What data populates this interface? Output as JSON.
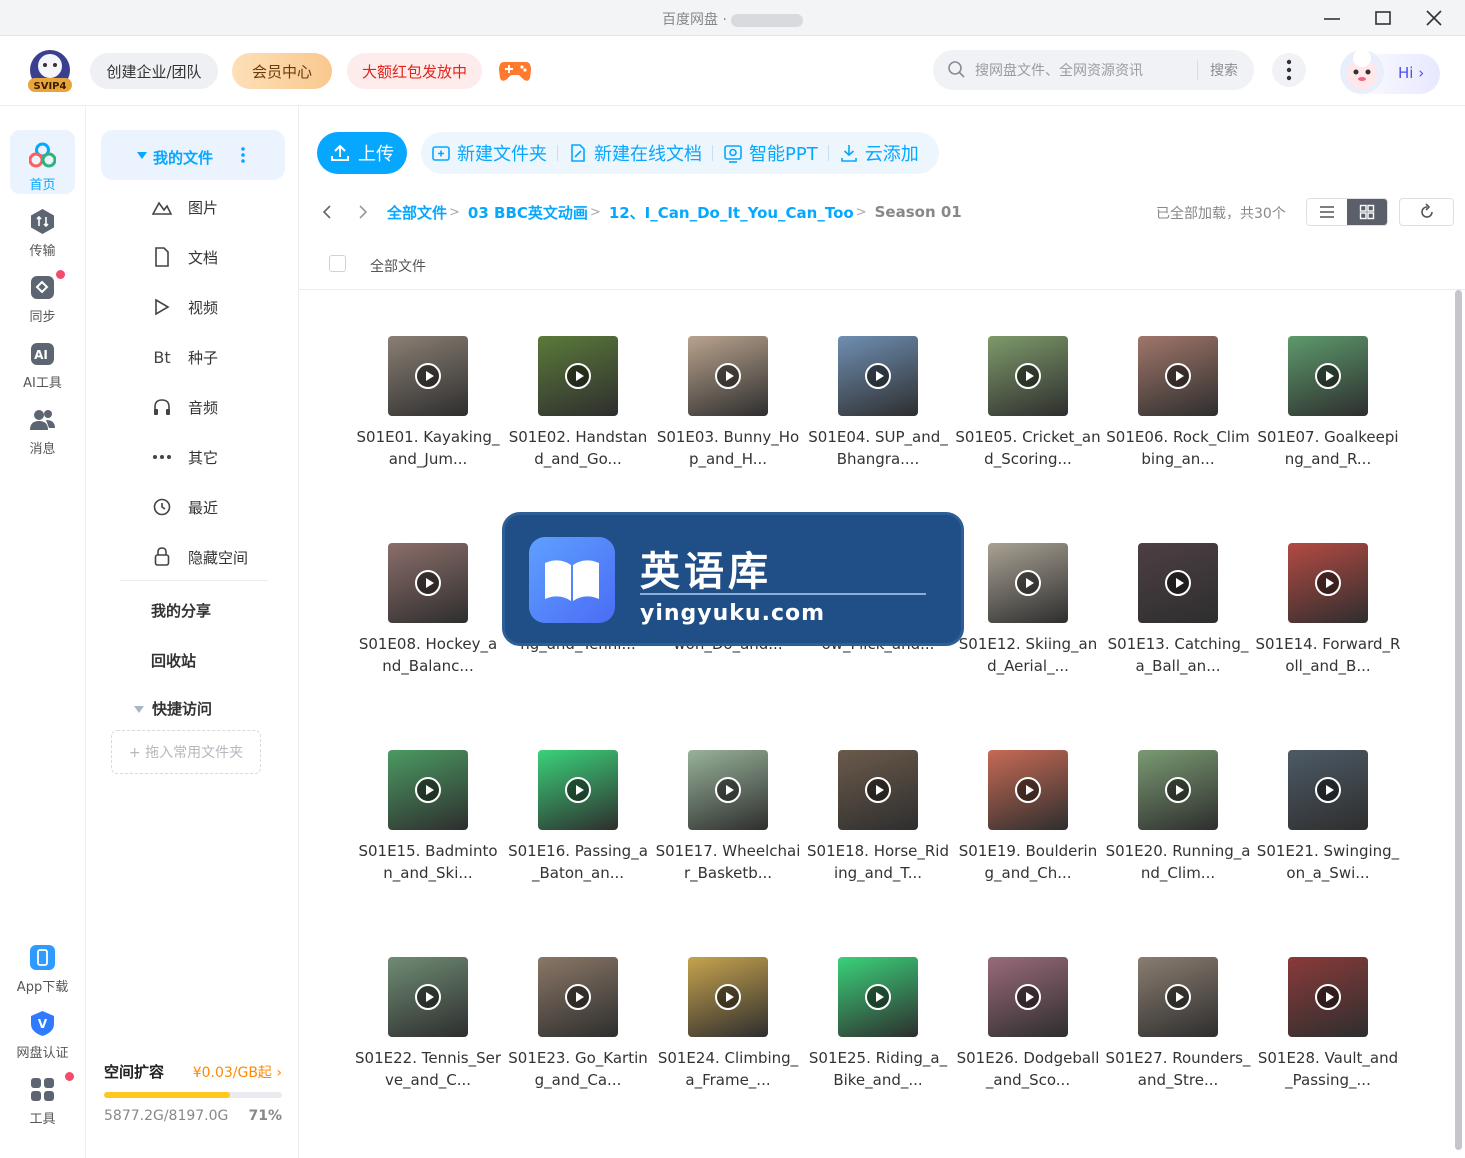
{
  "window": {
    "title": "百度网盘 ·"
  },
  "header": {
    "logo_text": "SVIP4",
    "team_label": "创建企业/团队",
    "vip_label": "会员中心",
    "redpacket_label": "大额红包发放中",
    "search_placeholder": "搜网盘文件、全网资源资讯",
    "search_button": "搜索",
    "hi_label": "Hi"
  },
  "rail": {
    "items": [
      {
        "label": "首页",
        "icon": "home-cloud-icon"
      },
      {
        "label": "传输",
        "icon": "transfer-icon"
      },
      {
        "label": "同步",
        "icon": "sync-icon"
      },
      {
        "label": "AI工具",
        "icon": "ai-tools-icon"
      },
      {
        "label": "消息",
        "icon": "message-icon"
      }
    ],
    "bottom": [
      {
        "label": "App下载",
        "icon": "app-download-icon"
      },
      {
        "label": "网盘认证",
        "icon": "verify-icon"
      },
      {
        "label": "工具",
        "icon": "tools-icon"
      }
    ]
  },
  "sidebar": {
    "my_files": "我的文件",
    "categories": [
      {
        "label": "图片",
        "icon": "image-icon"
      },
      {
        "label": "文档",
        "icon": "document-icon"
      },
      {
        "label": "视频",
        "icon": "video-icon"
      },
      {
        "label": "种子",
        "icon": "torrent-icon",
        "glyph": "Bt"
      },
      {
        "label": "音频",
        "icon": "audio-icon"
      },
      {
        "label": "其它",
        "icon": "other-icon"
      },
      {
        "label": "最近",
        "icon": "recent-icon"
      },
      {
        "label": "隐藏空间",
        "icon": "lock-icon"
      }
    ],
    "my_share": "我的分享",
    "recycle": "回收站",
    "quick_access": "快捷访问",
    "drop_hint": "+ 拖入常用文件夹",
    "space": {
      "title": "空间扩容",
      "price": "¥0.03/GB起",
      "usage": "5877.2G/8197.0G",
      "percent_label": "71%",
      "percent": 71
    }
  },
  "toolbar": {
    "upload": "上传",
    "new_folder": "新建文件夹",
    "new_doc": "新建在线文档",
    "ppt": "智能PPT",
    "cloud_add": "云添加"
  },
  "breadcrumb": {
    "items": [
      "全部文件",
      "03 BBC英文动画",
      "12、I_Can_Do_It_You_Can_Too"
    ],
    "current": "Season 01",
    "loaded_text": "已全部加载，共30个"
  },
  "list_header": {
    "all_files": "全部文件"
  },
  "files": [
    {
      "name": "S01E01. Kayaking_and_Jum...",
      "bg": "#8a7f74"
    },
    {
      "name": "S01E02. Handstand_and_Go...",
      "bg": "#5b7a3a"
    },
    {
      "name": "S01E03. Bunny_Hop_and_H...",
      "bg": "#b9a38e"
    },
    {
      "name": "S01E04. SUP_and_Bhangra....",
      "bg": "#6f8fb3"
    },
    {
      "name": "S01E05. Cricket_and_Scoring...",
      "bg": "#7e9a6a"
    },
    {
      "name": "S01E06. Rock_Climbing_an...",
      "bg": "#a0766a"
    },
    {
      "name": "S01E07. Goalkeeping_and_R...",
      "bg": "#5d9a6c"
    },
    {
      "name": "S01E08. Hockey_and_Balanc...",
      "bg": "#8b6e6a"
    },
    {
      "name": "ng_and_Tenni...",
      "bg": "#7a8c9a"
    },
    {
      "name": "won_Do_and...",
      "bg": "#8c8c8c"
    },
    {
      "name": "ow_Flick_and...",
      "bg": "#7a8d6e"
    },
    {
      "name": "S01E12. Skiing_and_Aerial_...",
      "bg": "#a9a294"
    },
    {
      "name": "S01E13. Catching_a_Ball_an...",
      "bg": "#4d3f45"
    },
    {
      "name": "S01E14. Forward_Roll_and_B...",
      "bg": "#b44a43"
    },
    {
      "name": "S01E15. Badminton_and_Ski...",
      "bg": "#4b9a62"
    },
    {
      "name": "S01E16. Passing_a_Baton_an...",
      "bg": "#3ad27a"
    },
    {
      "name": "S01E17. Wheelchair_Basketb...",
      "bg": "#98b29a"
    },
    {
      "name": "S01E18. Horse_Riding_and_T...",
      "bg": "#6b5a4b"
    },
    {
      "name": "S01E19. Bouldering_and_Ch...",
      "bg": "#c76a55"
    },
    {
      "name": "S01E20. Running_and_Clim...",
      "bg": "#7a9a72"
    },
    {
      "name": "S01E21. Swinging_on_a_Swi...",
      "bg": "#4d5a66"
    },
    {
      "name": "S01E22. Tennis_Serve_and_C...",
      "bg": "#6f8c74"
    },
    {
      "name": "S01E23. Go_Karting_and_Ca...",
      "bg": "#8a7766"
    },
    {
      "name": "S01E24. Climbing_a_Frame_...",
      "bg": "#c7a34e"
    },
    {
      "name": "S01E25. Riding_a_Bike_and_...",
      "bg": "#3ad27a"
    },
    {
      "name": "S01E26. Dodgeball_and_Sco...",
      "bg": "#9a6a7a"
    },
    {
      "name": "S01E27. Rounders_and_Stre...",
      "bg": "#8a7d70"
    },
    {
      "name": "S01E28. Vault_and_Passing_...",
      "bg": "#8a3a3a"
    }
  ],
  "watermark": {
    "cn": "英语库",
    "en": "yingyuku.com"
  },
  "colors": {
    "accent": "#06a7ff",
    "brand_red": "#e2231a",
    "storage_fill": "#ffc81e"
  }
}
